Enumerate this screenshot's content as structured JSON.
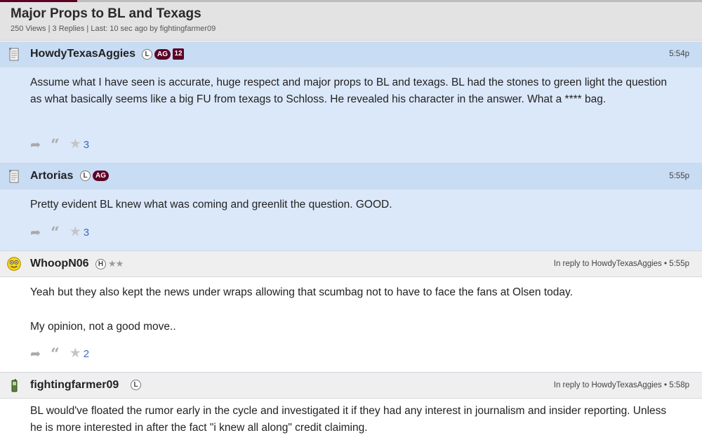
{
  "thread": {
    "title": "Major Props to BL and Texags",
    "meta": "250 Views | 3 Replies | Last: 10 sec ago by fightingfarmer09"
  },
  "posts": [
    {
      "username": "HowdyTexasAggies",
      "badges": [
        "L",
        "AG",
        "12"
      ],
      "time": "5:54p",
      "reply_to": "",
      "body": [
        "Assume what I have seen is accurate, huge respect and major props to BL and texags. BL had the stones to green light the question as what basically seems like a big FU from texags to Schloss. He revealed his character in the answer. What a **** bag."
      ],
      "stars": "3",
      "icon": "document-icon"
    },
    {
      "username": "Artorias",
      "badges": [
        "L",
        "AG"
      ],
      "time": "5:55p",
      "reply_to": "",
      "body": [
        "Pretty evident BL knew what was coming and greenlit the question. GOOD."
      ],
      "stars": "3",
      "icon": "document-icon"
    },
    {
      "username": "WhoopN06",
      "badges": [
        "H",
        "★★"
      ],
      "time": "In reply to HowdyTexasAggies • 5:55p",
      "reply_to": "HowdyTexasAggies",
      "body": [
        "Yeah but they also kept the news under wraps allowing that scumbag not to have to face the fans at Olsen today.",
        "My opinion, not a good move.."
      ],
      "stars": "2",
      "icon": "smiley-icon"
    },
    {
      "username": "fightingfarmer09",
      "badges": [
        "L"
      ],
      "time": "In reply to HowdyTexasAggies • 5:58p",
      "reply_to": "HowdyTexasAggies",
      "body": [
        "BL would've floated the rumor early in the cycle and investigated it if they had any interest in journalism and insider reporting. Unless he is more interested in after the fact \"i knew all along\" credit claiming."
      ],
      "stars": "",
      "icon": "phone-icon"
    }
  ],
  "colors": {
    "maroon": "#5c0025",
    "blue_header": "#c8dcf4",
    "blue_body": "#dbe8fa",
    "grey_header": "#efefef",
    "link_blue": "#3a6db5"
  }
}
